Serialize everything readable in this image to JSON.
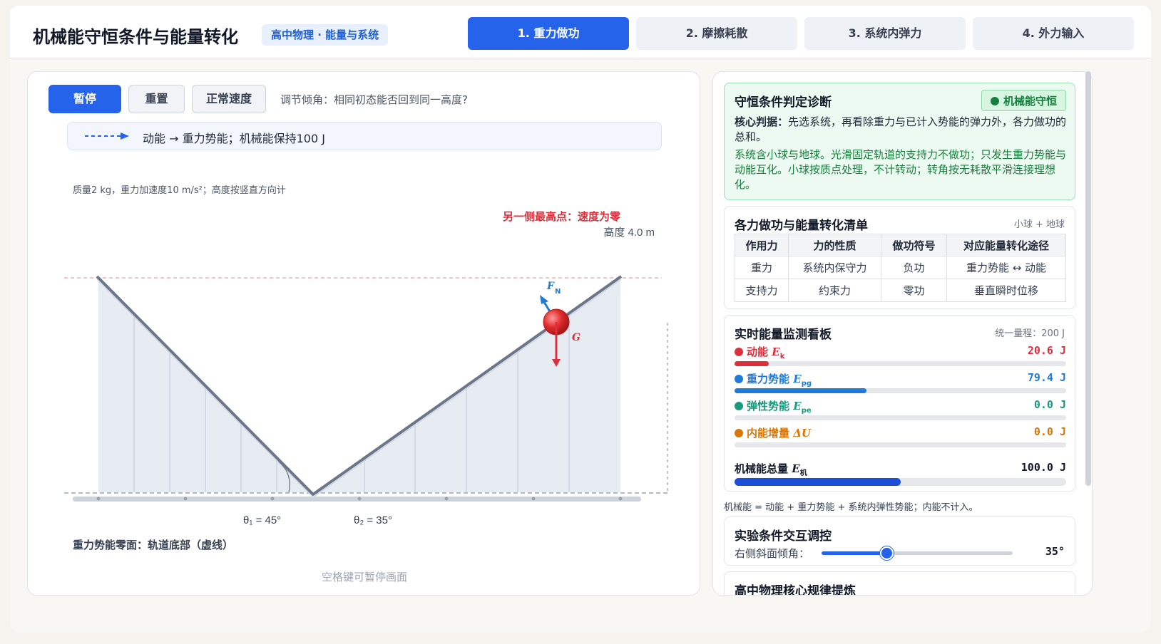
{
  "header": {
    "title": "机械能守恒条件与能量转化",
    "badge": "高中物理 · 能量与系统",
    "tabs": [
      "1. 重力做功",
      "2. 摩擦耗散",
      "3. 系统内弹力",
      "4. 外力输入"
    ],
    "active_tab": 0
  },
  "controls": {
    "pause_label": "暂停",
    "reset_label": "重置",
    "speed_label": "正常速度",
    "hint": "调节倾角：相同初态能否回到同一高度?"
  },
  "legend": {
    "text": "动能 → 重力势能；机械能保持100 J"
  },
  "simulation": {
    "mass_note": "质量2 kg，重力加速度10 m/s²；高度按竖直方向计",
    "max_point_label": "另一侧最高点：速度为零",
    "height_label": "高度 4.0 m",
    "angle_left": "θ₁ = 45°",
    "angle_right": "θ₂ = 35°",
    "force_normal": "F",
    "force_normal_sub": "N",
    "force_gravity": "G",
    "zero_note": "重力势能零面：轨道底部（虚线）",
    "space_note": "空格键可暂停画面"
  },
  "diagnosis": {
    "title": "守恒条件判定诊断",
    "status": "机械能守恒",
    "core_label": "核心判据：",
    "core_text": "先选系统，再看除重力与已计入势能的弹力外，各力做功的总和。",
    "detail": "系统含小球与地球。光滑固定轨道的支持力不做功；只发生重力势能与动能互化。小球按质点处理，不计转动；转角按无耗散平滑连接理想化。"
  },
  "work_table": {
    "title": "各力做功与能量转化清单",
    "meta": "小球 + 地球",
    "headers": [
      "作用力",
      "力的性质",
      "做功符号",
      "对应能量转化途径"
    ],
    "rows": [
      [
        "重力",
        "系统内保守力",
        "负功",
        "重力势能 ↔ 动能"
      ],
      [
        "支持力",
        "约束力",
        "零功",
        "垂直瞬时位移"
      ]
    ]
  },
  "energy": {
    "title": "实时能量监测看板",
    "meta": "统一量程：200 J",
    "max_value": 200,
    "items": [
      {
        "label": "动能",
        "symbol": "E",
        "sub": "k",
        "value_text": "20.6 J",
        "value": 20.6,
        "color": "#dc2f3c"
      },
      {
        "label": "重力势能",
        "symbol": "E",
        "sub": "pg",
        "value_text": "79.4 J",
        "value": 79.4,
        "color": "#1f7ad8"
      },
      {
        "label": "弹性势能",
        "symbol": "E",
        "sub": "pe",
        "value_text": "0.0 J",
        "value": 0.0,
        "color": "#1a9a7c"
      },
      {
        "label": "内能增量",
        "symbol": "ΔU",
        "sub": "",
        "value_text": "0.0 J",
        "value": 0.0,
        "color": "#d97706"
      }
    ],
    "total": {
      "label": "机械能总量",
      "symbol": "E",
      "sub": "机",
      "value_text": "100.0 J",
      "value": 100.0
    },
    "formula_note": "机械能 = 动能 + 重力势能 + 系统内弹性势能；内能不计入。"
  },
  "experiment": {
    "title": "实验条件交互调控",
    "slider_label": "右侧斜面倾角：",
    "slider_value_text": "35°",
    "slider_fraction": 0.34
  },
  "law": {
    "title": "高中物理核心规律提炼"
  },
  "colors": {
    "accent": "#2563eb",
    "success": "#15803d",
    "danger": "#dc2f3c"
  }
}
